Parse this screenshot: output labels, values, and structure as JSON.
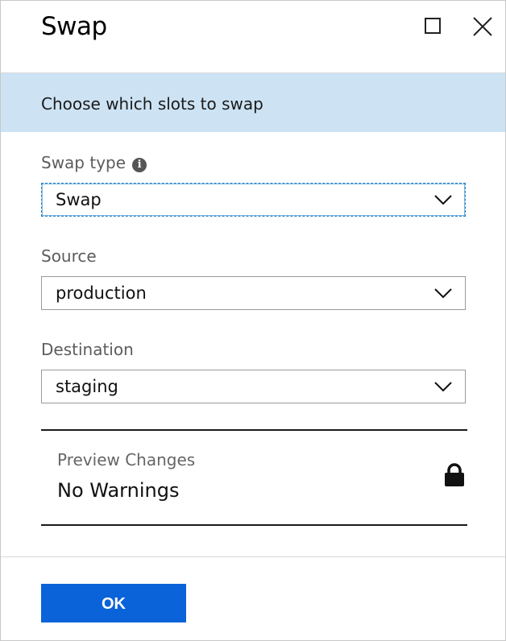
{
  "header": {
    "title": "Swap",
    "maximize_icon": "maximize-icon",
    "close_icon": "close-icon"
  },
  "banner": {
    "text": "Choose which slots to swap"
  },
  "swap_type": {
    "label": "Swap type",
    "value": "Swap",
    "info_icon": "info-icon"
  },
  "source": {
    "label": "Source",
    "value": "production"
  },
  "destination": {
    "label": "Destination",
    "value": "staging"
  },
  "preview": {
    "label": "Preview Changes",
    "value": "No Warnings",
    "icon": "lock-icon"
  },
  "footer": {
    "ok_label": "OK"
  },
  "colors": {
    "banner": "#cde3f4",
    "primary_button": "#0a63d8",
    "focus_border": "#1f7bc1"
  }
}
